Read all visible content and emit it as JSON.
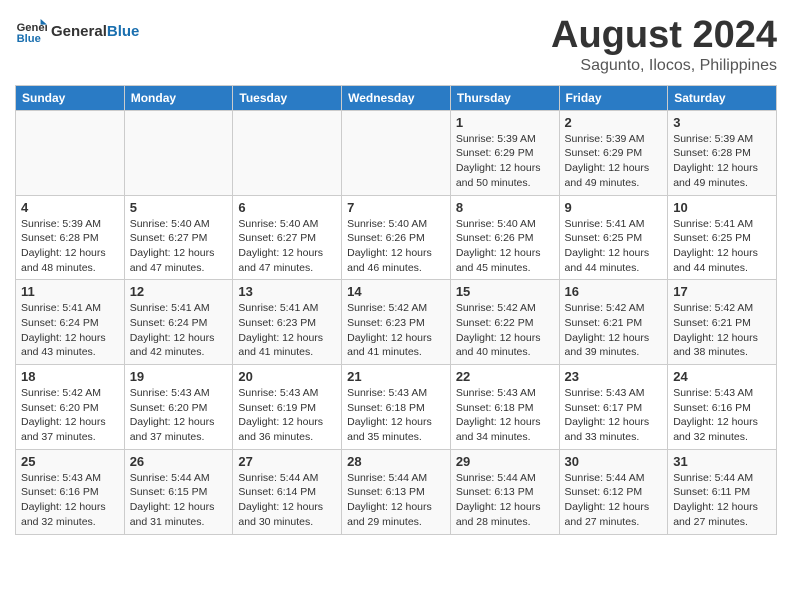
{
  "header": {
    "logo_line1": "General",
    "logo_line2": "Blue",
    "main_title": "August 2024",
    "sub_title": "Sagunto, Ilocos, Philippines"
  },
  "days_of_week": [
    "Sunday",
    "Monday",
    "Tuesday",
    "Wednesday",
    "Thursday",
    "Friday",
    "Saturday"
  ],
  "weeks": [
    [
      {
        "day": "",
        "info": ""
      },
      {
        "day": "",
        "info": ""
      },
      {
        "day": "",
        "info": ""
      },
      {
        "day": "",
        "info": ""
      },
      {
        "day": "1",
        "info": "Sunrise: 5:39 AM\nSunset: 6:29 PM\nDaylight: 12 hours and 50 minutes."
      },
      {
        "day": "2",
        "info": "Sunrise: 5:39 AM\nSunset: 6:29 PM\nDaylight: 12 hours and 49 minutes."
      },
      {
        "day": "3",
        "info": "Sunrise: 5:39 AM\nSunset: 6:28 PM\nDaylight: 12 hours and 49 minutes."
      }
    ],
    [
      {
        "day": "4",
        "info": "Sunrise: 5:39 AM\nSunset: 6:28 PM\nDaylight: 12 hours and 48 minutes."
      },
      {
        "day": "5",
        "info": "Sunrise: 5:40 AM\nSunset: 6:27 PM\nDaylight: 12 hours and 47 minutes."
      },
      {
        "day": "6",
        "info": "Sunrise: 5:40 AM\nSunset: 6:27 PM\nDaylight: 12 hours and 47 minutes."
      },
      {
        "day": "7",
        "info": "Sunrise: 5:40 AM\nSunset: 6:26 PM\nDaylight: 12 hours and 46 minutes."
      },
      {
        "day": "8",
        "info": "Sunrise: 5:40 AM\nSunset: 6:26 PM\nDaylight: 12 hours and 45 minutes."
      },
      {
        "day": "9",
        "info": "Sunrise: 5:41 AM\nSunset: 6:25 PM\nDaylight: 12 hours and 44 minutes."
      },
      {
        "day": "10",
        "info": "Sunrise: 5:41 AM\nSunset: 6:25 PM\nDaylight: 12 hours and 44 minutes."
      }
    ],
    [
      {
        "day": "11",
        "info": "Sunrise: 5:41 AM\nSunset: 6:24 PM\nDaylight: 12 hours and 43 minutes."
      },
      {
        "day": "12",
        "info": "Sunrise: 5:41 AM\nSunset: 6:24 PM\nDaylight: 12 hours and 42 minutes."
      },
      {
        "day": "13",
        "info": "Sunrise: 5:41 AM\nSunset: 6:23 PM\nDaylight: 12 hours and 41 minutes."
      },
      {
        "day": "14",
        "info": "Sunrise: 5:42 AM\nSunset: 6:23 PM\nDaylight: 12 hours and 41 minutes."
      },
      {
        "day": "15",
        "info": "Sunrise: 5:42 AM\nSunset: 6:22 PM\nDaylight: 12 hours and 40 minutes."
      },
      {
        "day": "16",
        "info": "Sunrise: 5:42 AM\nSunset: 6:21 PM\nDaylight: 12 hours and 39 minutes."
      },
      {
        "day": "17",
        "info": "Sunrise: 5:42 AM\nSunset: 6:21 PM\nDaylight: 12 hours and 38 minutes."
      }
    ],
    [
      {
        "day": "18",
        "info": "Sunrise: 5:42 AM\nSunset: 6:20 PM\nDaylight: 12 hours and 37 minutes."
      },
      {
        "day": "19",
        "info": "Sunrise: 5:43 AM\nSunset: 6:20 PM\nDaylight: 12 hours and 37 minutes."
      },
      {
        "day": "20",
        "info": "Sunrise: 5:43 AM\nSunset: 6:19 PM\nDaylight: 12 hours and 36 minutes."
      },
      {
        "day": "21",
        "info": "Sunrise: 5:43 AM\nSunset: 6:18 PM\nDaylight: 12 hours and 35 minutes."
      },
      {
        "day": "22",
        "info": "Sunrise: 5:43 AM\nSunset: 6:18 PM\nDaylight: 12 hours and 34 minutes."
      },
      {
        "day": "23",
        "info": "Sunrise: 5:43 AM\nSunset: 6:17 PM\nDaylight: 12 hours and 33 minutes."
      },
      {
        "day": "24",
        "info": "Sunrise: 5:43 AM\nSunset: 6:16 PM\nDaylight: 12 hours and 32 minutes."
      }
    ],
    [
      {
        "day": "25",
        "info": "Sunrise: 5:43 AM\nSunset: 6:16 PM\nDaylight: 12 hours and 32 minutes."
      },
      {
        "day": "26",
        "info": "Sunrise: 5:44 AM\nSunset: 6:15 PM\nDaylight: 12 hours and 31 minutes."
      },
      {
        "day": "27",
        "info": "Sunrise: 5:44 AM\nSunset: 6:14 PM\nDaylight: 12 hours and 30 minutes."
      },
      {
        "day": "28",
        "info": "Sunrise: 5:44 AM\nSunset: 6:13 PM\nDaylight: 12 hours and 29 minutes."
      },
      {
        "day": "29",
        "info": "Sunrise: 5:44 AM\nSunset: 6:13 PM\nDaylight: 12 hours and 28 minutes."
      },
      {
        "day": "30",
        "info": "Sunrise: 5:44 AM\nSunset: 6:12 PM\nDaylight: 12 hours and 27 minutes."
      },
      {
        "day": "31",
        "info": "Sunrise: 5:44 AM\nSunset: 6:11 PM\nDaylight: 12 hours and 27 minutes."
      }
    ]
  ]
}
